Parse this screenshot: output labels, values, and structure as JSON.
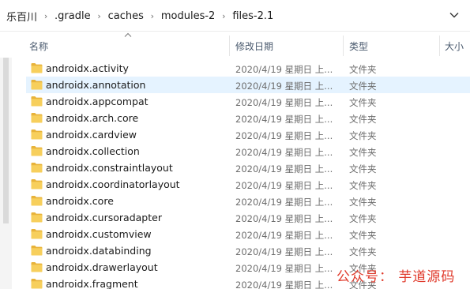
{
  "breadcrumb": [
    "乐百川",
    ".gradle",
    "caches",
    "modules-2",
    "files-2.1"
  ],
  "columns": {
    "name": "名称",
    "date": "修改日期",
    "type": "类型",
    "size": "大小"
  },
  "rows": [
    {
      "name": "androidx.activity",
      "date": "2020/4/19 星期日 上...",
      "type": "文件夹"
    },
    {
      "name": "androidx.annotation",
      "date": "2020/4/19 星期日 上...",
      "type": "文件夹",
      "hover": true
    },
    {
      "name": "androidx.appcompat",
      "date": "2020/4/19 星期日 上...",
      "type": "文件夹"
    },
    {
      "name": "androidx.arch.core",
      "date": "2020/4/19 星期日 上...",
      "type": "文件夹"
    },
    {
      "name": "androidx.cardview",
      "date": "2020/4/19 星期日 上...",
      "type": "文件夹"
    },
    {
      "name": "androidx.collection",
      "date": "2020/4/19 星期日 上...",
      "type": "文件夹"
    },
    {
      "name": "androidx.constraintlayout",
      "date": "2020/4/19 星期日 上...",
      "type": "文件夹"
    },
    {
      "name": "androidx.coordinatorlayout",
      "date": "2020/4/19 星期日 上...",
      "type": "文件夹"
    },
    {
      "name": "androidx.core",
      "date": "2020/4/19 星期日 上...",
      "type": "文件夹"
    },
    {
      "name": "androidx.cursoradapter",
      "date": "2020/4/19 星期日 上...",
      "type": "文件夹"
    },
    {
      "name": "androidx.customview",
      "date": "2020/4/19 星期日 上...",
      "type": "文件夹"
    },
    {
      "name": "androidx.databinding",
      "date": "2020/4/19 星期日 上...",
      "type": "文件夹"
    },
    {
      "name": "androidx.drawerlayout",
      "date": "2020/4/19 星期日 上...",
      "type": "文件夹"
    },
    {
      "name": "androidx.fragment",
      "date": "2020/4/19 星期日 上...",
      "type": "文件夹"
    }
  ],
  "watermark": "公众号：  芋道源码",
  "icons": {
    "folder": "folder-icon",
    "separator": "chevron-right-icon",
    "dropdown": "chevron-down-icon",
    "sort": "sort-up-icon"
  },
  "colors": {
    "folder": "#f5c542",
    "hover_row": "#e5f3ff",
    "watermark": "#e03a2b"
  }
}
